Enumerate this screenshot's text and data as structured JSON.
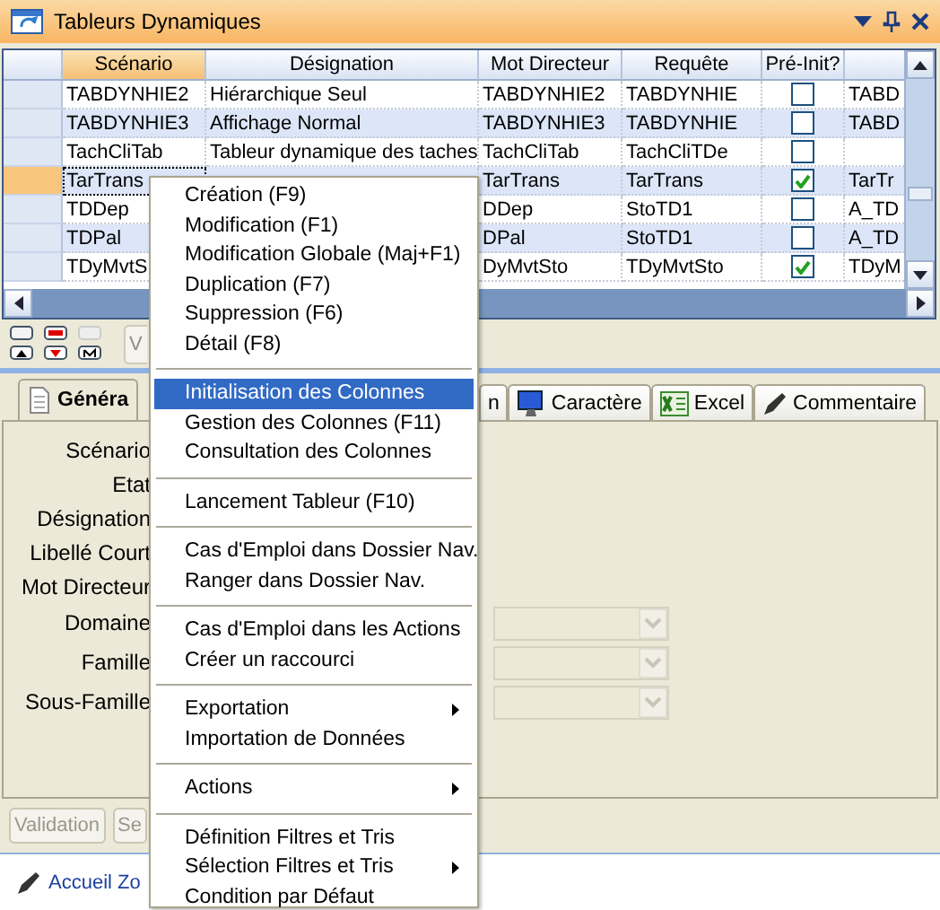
{
  "window": {
    "title": "Tableurs Dynamiques"
  },
  "grid": {
    "columns": [
      "Scénario",
      "Désignation",
      "Mot Directeur",
      "Requête",
      "Pré-Init?",
      ""
    ],
    "rows": [
      {
        "selected": false,
        "cells": [
          "TABDYNHIE2",
          "Hiérarchique Seul",
          "TABDYNHIE2",
          "TABDYNHIE",
          "",
          "TABD"
        ],
        "checked": false
      },
      {
        "selected": false,
        "cells": [
          "TABDYNHIE3",
          "Affichage Normal",
          "TABDYNHIE3",
          "TABDYNHIE",
          "",
          "TABD"
        ],
        "checked": false
      },
      {
        "selected": false,
        "cells": [
          "TachCliTab",
          "Tableur dynamique des taches",
          "TachCliTab",
          "TachCliTDe",
          "",
          ""
        ],
        "checked": false
      },
      {
        "selected": true,
        "cells": [
          "TarTrans",
          "",
          "TarTrans",
          "TarTrans",
          "",
          "TarTr"
        ],
        "checked": true
      },
      {
        "selected": false,
        "cells": [
          "TDDep",
          "",
          "DDep",
          "StoTD1",
          "",
          "A_TD"
        ],
        "checked": false
      },
      {
        "selected": false,
        "cells": [
          "TDPal",
          "",
          "DPal",
          "StoTD1",
          "",
          "A_TD"
        ],
        "checked": false
      },
      {
        "selected": false,
        "cells": [
          "TDyMvtS",
          "",
          "DyMvtSto",
          "TDyMvtSto",
          "",
          "TDyM"
        ],
        "checked": true
      }
    ]
  },
  "toolbar": {
    "button": "V"
  },
  "tabs": [
    {
      "label": "Généra",
      "selected": true
    },
    {
      "label": "n",
      "selected": false
    },
    {
      "label": "Caractère",
      "selected": false
    },
    {
      "label": "Excel",
      "selected": false
    },
    {
      "label": "Commentaire",
      "selected": false
    }
  ],
  "form": [
    {
      "label": "Scénario",
      "kind": "text"
    },
    {
      "label": "Etat",
      "kind": "text"
    },
    {
      "label": "Désignation",
      "kind": "text"
    },
    {
      "label": "Libellé Court",
      "kind": "text"
    },
    {
      "label": "Mot Directeur",
      "kind": "text"
    },
    {
      "label": "Domaine",
      "kind": "combo"
    },
    {
      "label": "Famille",
      "kind": "combo"
    },
    {
      "label": "Sous-Famille",
      "kind": "combo"
    }
  ],
  "buttons": [
    {
      "label": "Validation",
      "disabled": true
    },
    {
      "label": "Se",
      "disabled": true
    }
  ],
  "footer": {
    "link": "Accueil Zo"
  },
  "menu": [
    {
      "kind": "item",
      "label": "Création (F9)",
      "selected": false,
      "submenu": false
    },
    {
      "kind": "item",
      "label": "Modification (F1)",
      "selected": false,
      "submenu": false
    },
    {
      "kind": "item",
      "label": "Modification Globale (Maj+F1)",
      "selected": false,
      "submenu": false
    },
    {
      "kind": "item",
      "label": "Duplication (F7)",
      "selected": false,
      "submenu": false
    },
    {
      "kind": "item",
      "label": "Suppression (F6)",
      "selected": false,
      "submenu": false
    },
    {
      "kind": "item",
      "label": "Détail (F8)",
      "selected": false,
      "submenu": false
    },
    {
      "kind": "separator"
    },
    {
      "kind": "item",
      "label": "Initialisation des Colonnes",
      "selected": true,
      "submenu": false
    },
    {
      "kind": "item",
      "label": "Gestion des Colonnes (F11)",
      "selected": false,
      "submenu": false
    },
    {
      "kind": "item",
      "label": "Consultation des Colonnes",
      "selected": false,
      "submenu": false
    },
    {
      "kind": "separator"
    },
    {
      "kind": "item",
      "label": "Lancement Tableur (F10)",
      "selected": false,
      "submenu": false
    },
    {
      "kind": "separator"
    },
    {
      "kind": "item",
      "label": "Cas d'Emploi dans Dossier Nav.",
      "selected": false,
      "submenu": false
    },
    {
      "kind": "item",
      "label": "Ranger dans Dossier Nav.",
      "selected": false,
      "submenu": false
    },
    {
      "kind": "separator"
    },
    {
      "kind": "item",
      "label": "Cas d'Emploi dans les Actions",
      "selected": false,
      "submenu": false
    },
    {
      "kind": "item",
      "label": "Créer un raccourci",
      "selected": false,
      "submenu": false
    },
    {
      "kind": "separator"
    },
    {
      "kind": "item",
      "label": "Exportation",
      "selected": false,
      "submenu": true
    },
    {
      "kind": "item",
      "label": "Importation de Données",
      "selected": false,
      "submenu": false
    },
    {
      "kind": "separator"
    },
    {
      "kind": "item",
      "label": "Actions",
      "selected": false,
      "submenu": true
    },
    {
      "kind": "separator"
    },
    {
      "kind": "item",
      "label": "Définition Filtres et Tris",
      "selected": false,
      "submenu": false
    },
    {
      "kind": "item",
      "label": "Sélection Filtres et Tris",
      "selected": false,
      "submenu": true
    },
    {
      "kind": "item",
      "label": "Condition par Défaut",
      "selected": false,
      "submenu": false
    }
  ]
}
